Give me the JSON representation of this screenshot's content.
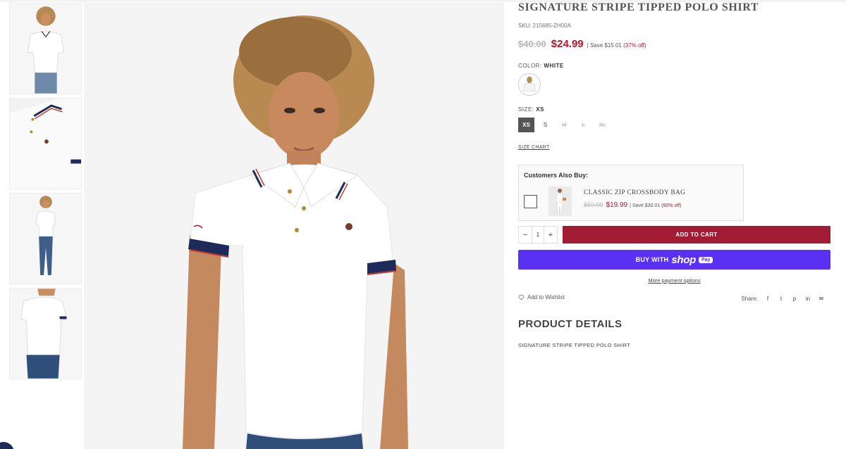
{
  "product": {
    "title": "SIGNATURE STRIPE TIPPED POLO SHIRT",
    "sku_label": "SKU:",
    "sku": "215685-ZH00A",
    "old_price": "$40.00",
    "new_price": "$24.99",
    "save_text": "| Save $15.01",
    "save_pct": "(37% off)"
  },
  "color": {
    "label": "COLOR:",
    "value": "WHITE"
  },
  "size": {
    "label": "SIZE:",
    "value": "XS",
    "options": [
      {
        "label": "XS",
        "state": "active"
      },
      {
        "label": "S",
        "state": "available"
      },
      {
        "label": "M",
        "state": "disabled"
      },
      {
        "label": "L",
        "state": "disabled"
      },
      {
        "label": "XL",
        "state": "disabled"
      }
    ],
    "chart_link": "SIZE CHART"
  },
  "also_buy": {
    "title": "Customers Also Buy:",
    "name": "CLASSIC ZIP CROSSBODY BAG",
    "old_price": "$50.00",
    "new_price": "$19.99",
    "save_text": "| Save $30.01",
    "save_pct": "(60% off)"
  },
  "cart": {
    "qty_minus": "−",
    "qty_value": "1",
    "qty_plus": "+",
    "add_label": "ADD TO CART",
    "buy_with": "BUY WITH",
    "shop_word": "shop",
    "pay_word": "Pay",
    "more_options": "More payment options"
  },
  "wishlist_label": "Add to Wishlist",
  "share": {
    "label": "Share:",
    "icons": [
      "f",
      "t",
      "p",
      "in",
      "✉"
    ]
  },
  "details": {
    "heading": "PRODUCT DETAILS",
    "text": "SIGNATURE STRIPE TIPPED POLO SHIRT"
  },
  "colors": {
    "accent": "#a31c35",
    "sale": "#b5162d",
    "shop_pay": "#5a31f4"
  }
}
